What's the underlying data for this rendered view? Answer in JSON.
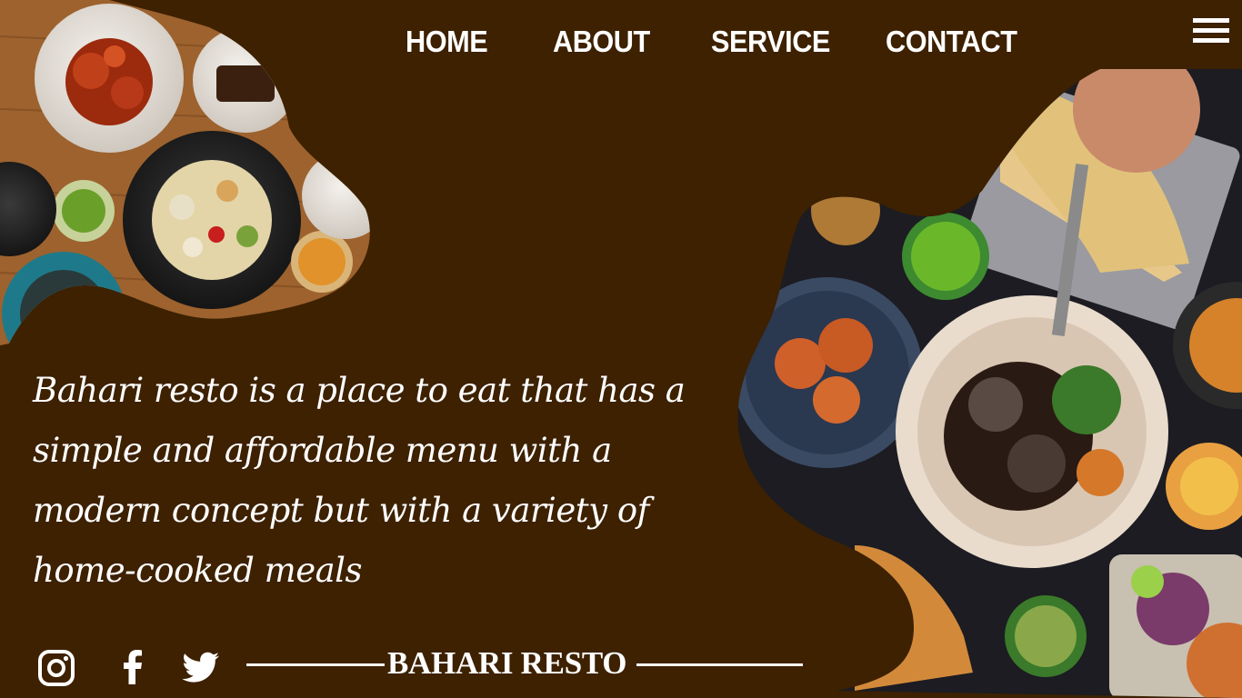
{
  "nav": {
    "home": "HOME",
    "about": "ABOUT",
    "service": "SERVICE",
    "contact": "CONTACT"
  },
  "menu_icon": "hamburger-menu-icon",
  "hero": {
    "tagline": "Bahari resto is a place to eat that has a simple and affordable menu with a modern concept but with a variety of home-cooked meals"
  },
  "social": {
    "icons": [
      "instagram-icon",
      "facebook-icon",
      "twitter-icon"
    ]
  },
  "brand": "BAHARI RESTO",
  "colors": {
    "background": "#3d2101",
    "text": "#ffffff"
  }
}
